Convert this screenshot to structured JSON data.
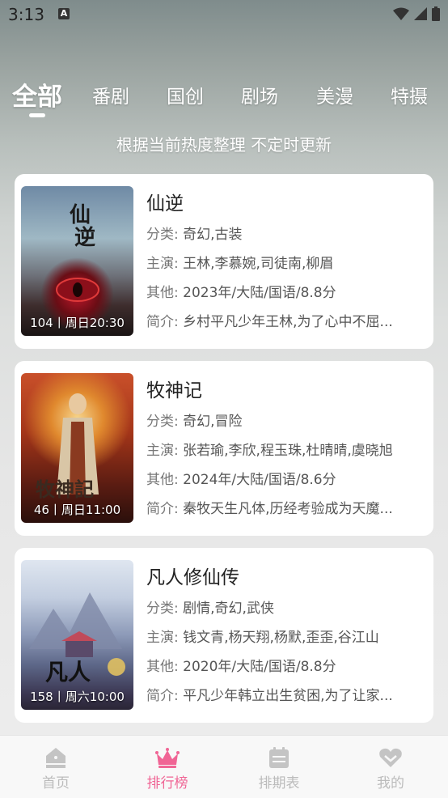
{
  "status": {
    "time": "3:13",
    "notification_icon": "A"
  },
  "tabs": [
    {
      "label": "全部",
      "active": true
    },
    {
      "label": "番剧"
    },
    {
      "label": "国创"
    },
    {
      "label": "剧场"
    },
    {
      "label": "美漫"
    },
    {
      "label": "特摄"
    }
  ],
  "subtitle": "根据当前热度整理 不定时更新",
  "cards": [
    {
      "title": "仙逆",
      "poster_label": "104丨周日20:30",
      "category_label": "分类:",
      "category": "奇幻,古装",
      "cast_label": "主演:",
      "cast": "王林,李慕婉,司徒南,柳眉",
      "other_label": "其他:",
      "other": "2023年/大陆/国语/8.8分",
      "intro_label": "简介:",
      "intro": "乡村平凡少年王林,为了心中不屈..."
    },
    {
      "title": "牧神记",
      "poster_label": "46丨周日11:00",
      "category_label": "分类:",
      "category": "奇幻,冒险",
      "cast_label": "主演:",
      "cast": "张若瑜,李欣,程玉珠,杜晴晴,虞晓旭",
      "other_label": "其他:",
      "other": "2024年/大陆/国语/8.6分",
      "intro_label": "简介:",
      "intro": "秦牧天生凡体,历经考验成为天魔..."
    },
    {
      "title": "凡人修仙传",
      "poster_label": "158丨周六10:00",
      "category_label": "分类:",
      "category": "剧情,奇幻,武侠",
      "cast_label": "主演:",
      "cast": "钱文青,杨天翔,杨默,歪歪,谷江山",
      "other_label": "其他:",
      "other": "2020年/大陆/国语/8.8分",
      "intro_label": "简介:",
      "intro": "平凡少年韩立出生贫困,为了让家..."
    }
  ],
  "bottom_nav": [
    {
      "label": "首页",
      "icon": "home-icon"
    },
    {
      "label": "排行榜",
      "icon": "crown-icon",
      "active": true
    },
    {
      "label": "排期表",
      "icon": "calendar-icon"
    },
    {
      "label": "我的",
      "icon": "heart-icon"
    }
  ],
  "colors": {
    "accent": "#f06595",
    "inactive": "#bbbbbb"
  }
}
